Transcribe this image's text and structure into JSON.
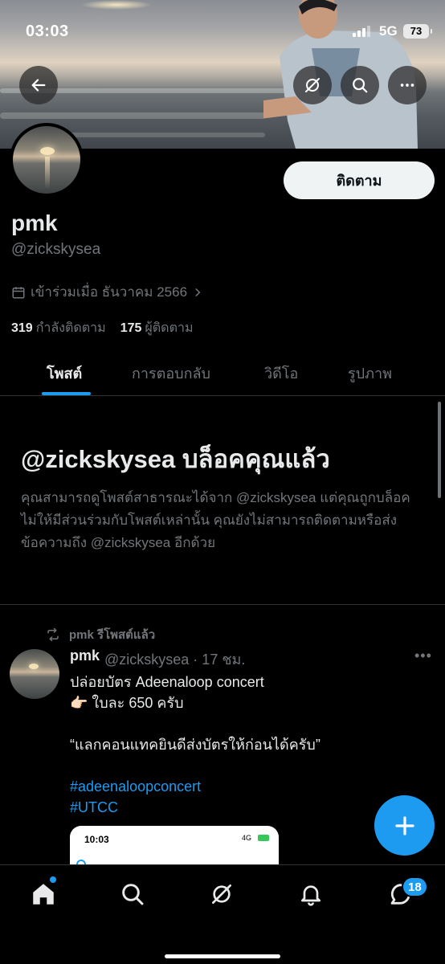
{
  "status_bar": {
    "time": "03:03",
    "network": "5G",
    "battery": "73"
  },
  "profile": {
    "follow_label": "ติดตาม",
    "display_name": "pmk",
    "handle": "@zickskysea",
    "joined": "เข้าร่วมเมื่อ ธันวาคม 2566",
    "following_count": "319",
    "following_label": "กำลังติดตาม",
    "followers_count": "175",
    "followers_label": "ผู้ติดตาม"
  },
  "tabs": [
    {
      "label": "โพสต์",
      "active": true
    },
    {
      "label": "การตอบกลับ",
      "active": false
    },
    {
      "label": "วิดีโอ",
      "active": false
    },
    {
      "label": "รูปภาพ",
      "active": false
    }
  ],
  "blocked": {
    "title": "@zickskysea บล็อคคุณแล้ว",
    "body": "คุณสามารถดูโพสต์สาธารณะได้จาก @zickskysea แต่คุณถูกบล็อคไม่ให้มีส่วนร่วมกับโพสต์เหล่านั้น คุณยังไม่สามารถติดตามหรือส่งข้อความถึง @zickskysea อีกด้วย"
  },
  "post": {
    "repost_label": "pmk รีโพสต์แล้ว",
    "author_name": "pmk",
    "author_handle": "@zickskysea · 17 ชม.",
    "line1": "ปล่อยบัตร Adeenaloop concert",
    "line2": "👉🏻 ใบละ 650 ครับ",
    "line3": "“แลกคอนแทคยินดีส่งบัตรให้ก่อนได้ครับ”",
    "hashtag1": "#adeenaloopconcert",
    "hashtag2": "#UTCC",
    "media_time": "10:03",
    "media_status": "4G"
  },
  "bottom_nav": {
    "messages_badge": "18"
  },
  "colors": {
    "accent": "#1d9bf0",
    "background": "#000000",
    "muted": "#71767b"
  }
}
